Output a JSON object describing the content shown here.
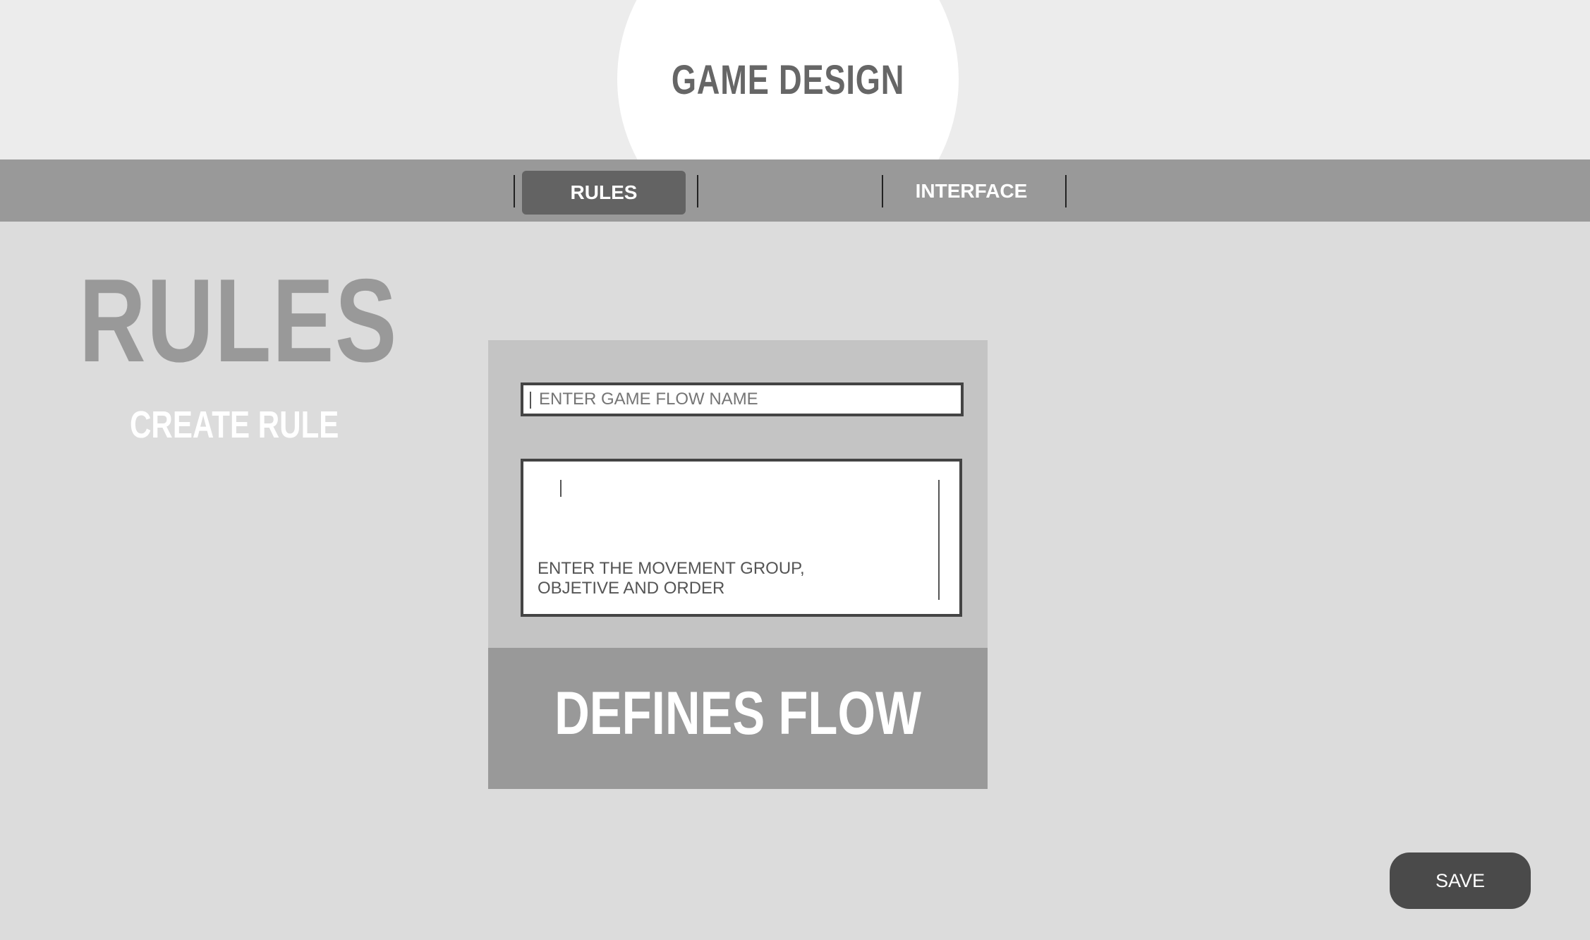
{
  "header": {
    "title": "GAME DESIGN"
  },
  "nav": {
    "tabs": [
      {
        "label": "RULES",
        "active": true
      },
      {
        "label": "",
        "active": false
      },
      {
        "label": "INTERFACE",
        "active": false
      }
    ]
  },
  "page": {
    "heading": "RULES",
    "subheading": "CREATE RULE"
  },
  "form": {
    "name_placeholder": "ENTER GAME FLOW NAME",
    "description_placeholder_line1": "ENTER THE MOVEMENT GROUP,",
    "description_placeholder_line2": "OBJETIVE AND ORDER",
    "footer_label": "DEFINES FLOW"
  },
  "actions": {
    "save_label": "SAVE"
  },
  "colors": {
    "header_bg": "#ececec",
    "nav_bg": "#999999",
    "active_tab": "#636363",
    "page_bg": "#dcdcdc",
    "save_button": "#4a4a4a"
  }
}
